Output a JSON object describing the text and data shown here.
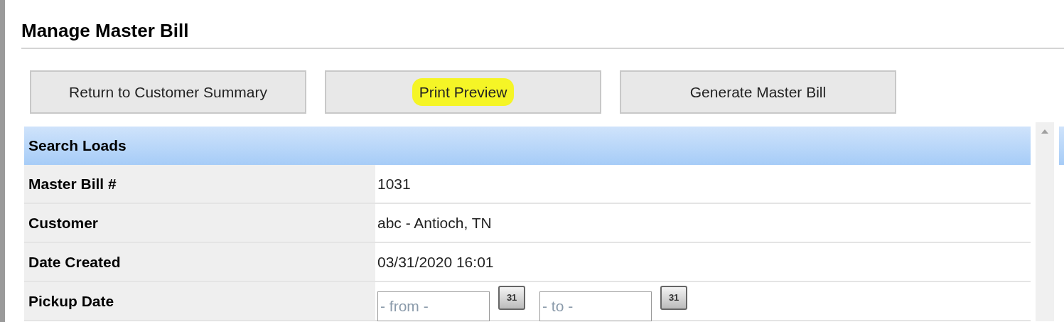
{
  "page_title": "Manage Master Bill",
  "buttons": [
    {
      "label": "Return to Customer Summary",
      "highlighted": false
    },
    {
      "label": "Print Preview",
      "highlighted": true
    },
    {
      "label": "Generate Master Bill",
      "highlighted": false
    }
  ],
  "panel": {
    "title": "Search Loads",
    "rows": [
      {
        "kind": "text",
        "label": "Master Bill #",
        "value": "1031"
      },
      {
        "kind": "text",
        "label": "Customer",
        "value": "abc - Antioch, TN"
      },
      {
        "kind": "text",
        "label": "Date Created",
        "value": "03/31/2020 16:01"
      },
      {
        "kind": "daterange",
        "label": "Pickup Date",
        "fields": [
          {
            "placeholder": "- from -",
            "calendar": "31"
          },
          {
            "placeholder": "- to -",
            "calendar": "31"
          }
        ]
      }
    ]
  }
}
